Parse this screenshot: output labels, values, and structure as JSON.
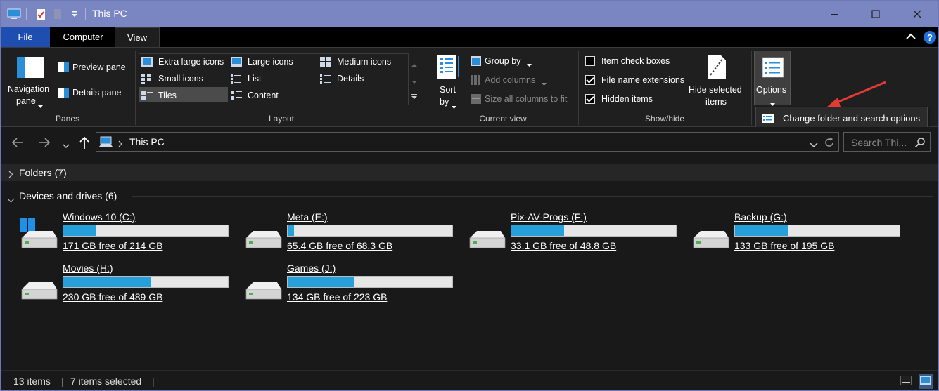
{
  "window": {
    "title": "This PC"
  },
  "tabs": {
    "file": "File",
    "computer": "Computer",
    "view": "View"
  },
  "ribbon": {
    "panes": {
      "label": "Panes",
      "navigation_pane_line1": "Navigation",
      "navigation_pane_line2": "pane",
      "preview_pane": "Preview pane",
      "details_pane": "Details pane"
    },
    "layout": {
      "label": "Layout",
      "items": [
        "Extra large icons",
        "Large icons",
        "Medium icons",
        "Small icons",
        "List",
        "Details",
        "Tiles",
        "Content"
      ],
      "selected": "Tiles"
    },
    "current_view": {
      "label": "Current view",
      "sort_line1": "Sort",
      "sort_line2": "by",
      "group_by": "Group by",
      "add_columns": "Add columns",
      "size_all_columns": "Size all columns to fit"
    },
    "show_hide": {
      "label": "Show/hide",
      "item_check_boxes": "Item check boxes",
      "file_name_extensions": "File name extensions",
      "hidden_items": "Hidden items",
      "hide_selected_line1": "Hide selected",
      "hide_selected_line2": "items",
      "checked": {
        "item_check_boxes": false,
        "file_name_extensions": true,
        "hidden_items": true
      }
    },
    "options": {
      "label": "Options"
    }
  },
  "tooltip": {
    "text": "Change folder and search options"
  },
  "address": {
    "location": "This PC",
    "search_placeholder": "Search Thi..."
  },
  "content": {
    "folders_header": "Folders (7)",
    "devices_header": "Devices and drives (6)",
    "drives": [
      {
        "name": "Windows 10 (C:)",
        "free": "171 GB free of 214 GB",
        "used_fraction": 0.2,
        "system": true
      },
      {
        "name": "Meta (E:)",
        "free": "65.4 GB free of 68.3 GB",
        "used_fraction": 0.04,
        "system": false
      },
      {
        "name": "Pix-AV-Progs (F:)",
        "free": "33.1 GB free of 48.8 GB",
        "used_fraction": 0.32,
        "system": false
      },
      {
        "name": "Backup (G:)",
        "free": "133 GB free of 195 GB",
        "used_fraction": 0.32,
        "system": false
      },
      {
        "name": "Movies (H:)",
        "free": "230 GB free of 489 GB",
        "used_fraction": 0.53,
        "system": false
      },
      {
        "name": "Games (J:)",
        "free": "134 GB free of 223 GB",
        "used_fraction": 0.4,
        "system": false
      }
    ]
  },
  "status": {
    "items": "13 items",
    "selected": "7 items selected"
  },
  "colors": {
    "accent": "#1e4fb0",
    "titlebar": "#7a86c2",
    "bar_fill": "#26a0da",
    "arrow": "#e53935"
  }
}
